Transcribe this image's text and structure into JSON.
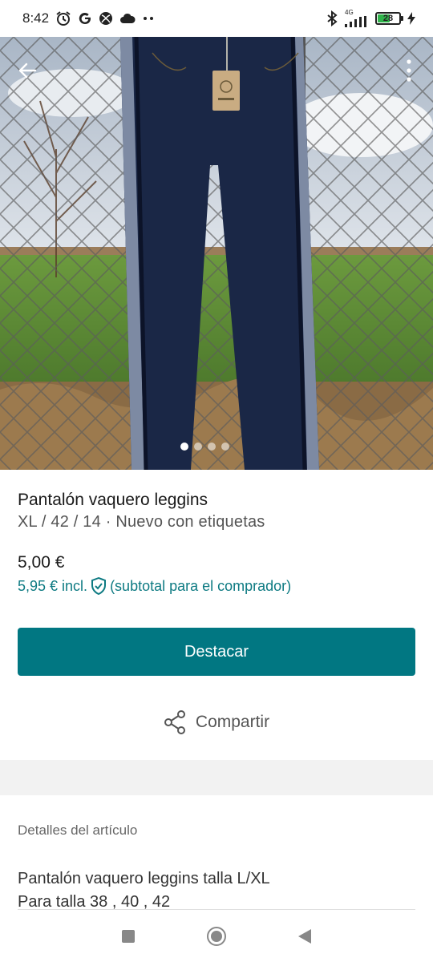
{
  "status_bar": {
    "time": "8:42",
    "network": "4G",
    "battery": "28"
  },
  "gallery": {
    "image_count": 4,
    "active_index": 0
  },
  "item": {
    "title": "Pantalón vaquero leggins",
    "subtitle": "XL / 42 / 14 · Nuevo con etiquetas",
    "price": "5,00 €",
    "price_incl": "5,95 € incl.",
    "price_incl_note": "(subtotal para el comprador)"
  },
  "actions": {
    "promote_label": "Destacar",
    "share_label": "Compartir"
  },
  "details": {
    "heading": "Detalles del artículo",
    "description_line1": "Pantalón vaquero leggins talla L/XL",
    "description_line2": "Para talla 38 , 40 , 42"
  },
  "colors": {
    "accent": "#017782",
    "accent_text": "#0d7a82"
  },
  "icons": {
    "back": "arrow-left-icon",
    "more": "more-vertical-icon",
    "shield": "shield-check-icon",
    "share": "share-icon"
  }
}
